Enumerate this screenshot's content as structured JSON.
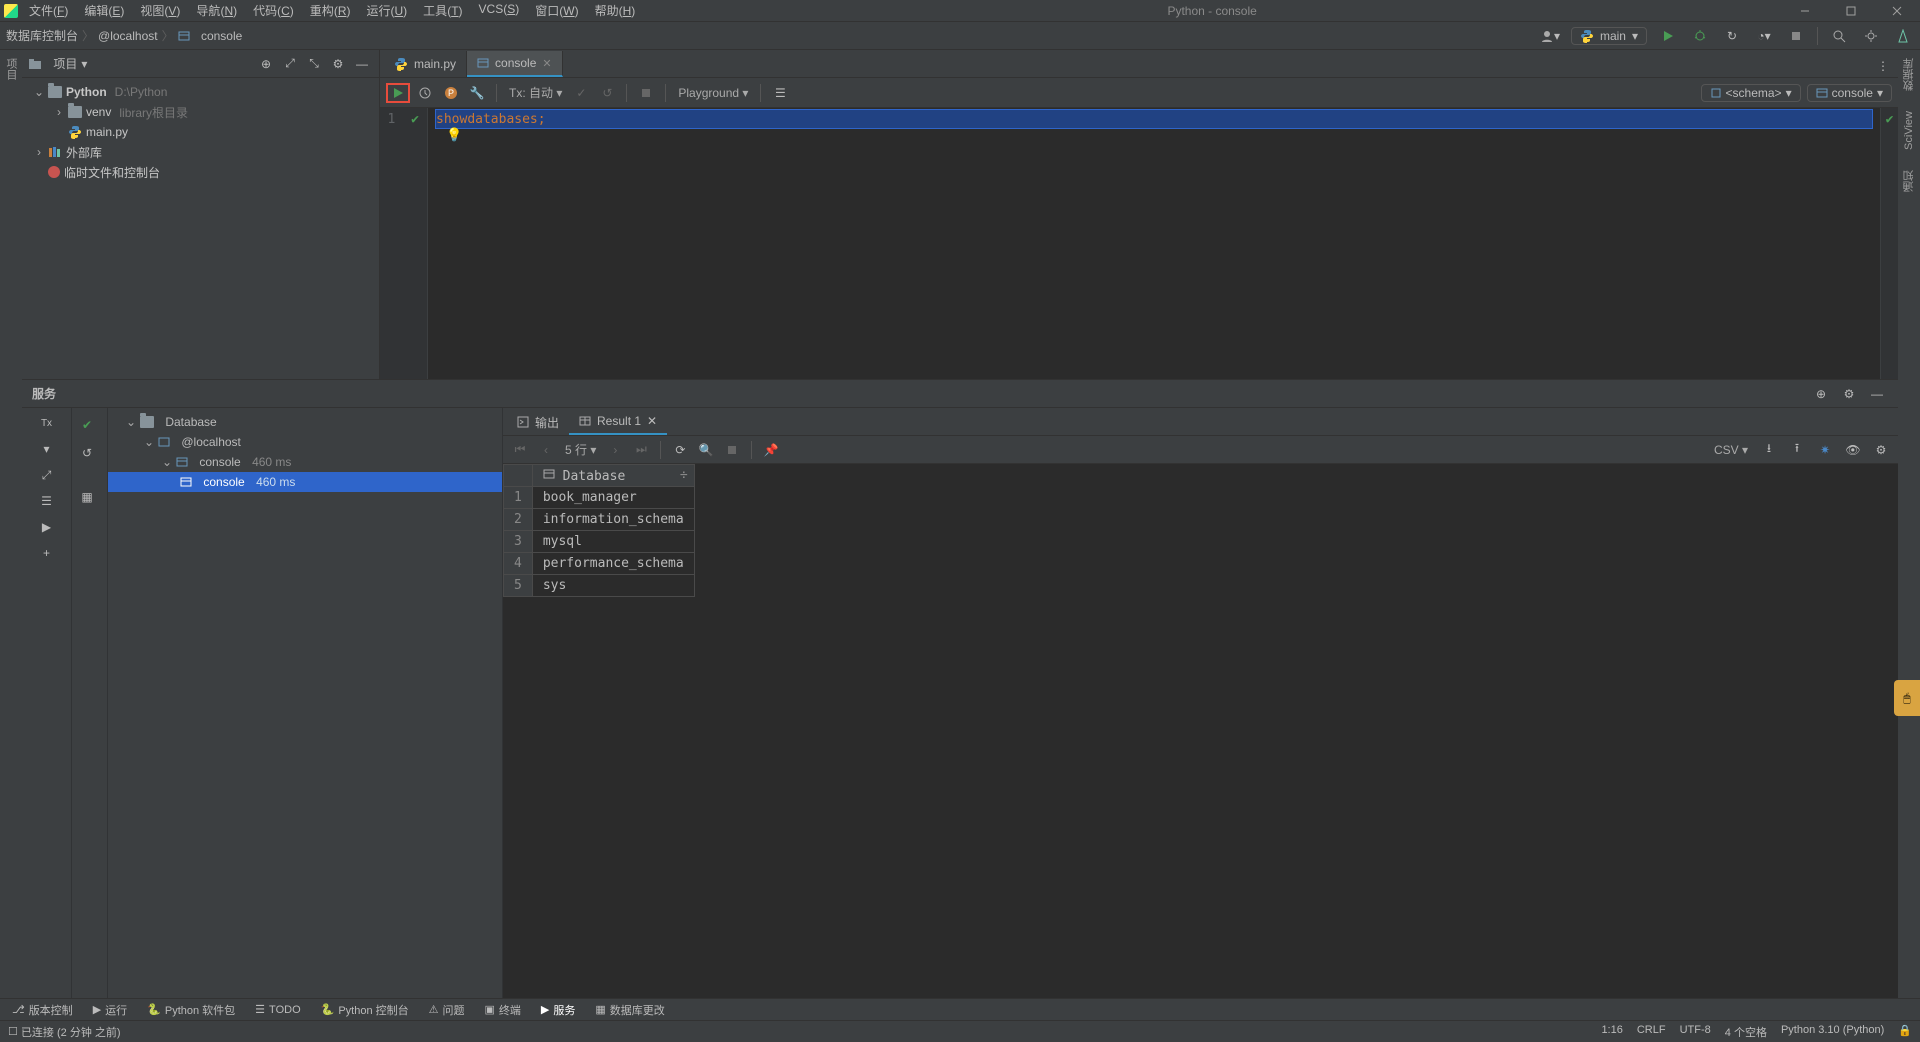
{
  "window": {
    "title": "Python - console"
  },
  "menu": {
    "items": [
      {
        "label": "文件",
        "key": "F"
      },
      {
        "label": "编辑",
        "key": "E"
      },
      {
        "label": "视图",
        "key": "V"
      },
      {
        "label": "导航",
        "key": "N"
      },
      {
        "label": "代码",
        "key": "C"
      },
      {
        "label": "重构",
        "key": "R"
      },
      {
        "label": "运行",
        "key": "U"
      },
      {
        "label": "工具",
        "key": "T"
      },
      {
        "label": "VCS",
        "key": "S"
      },
      {
        "label": "窗口",
        "key": "W"
      },
      {
        "label": "帮助",
        "key": "H"
      }
    ]
  },
  "breadcrumb": {
    "items": [
      "数据库控制台",
      "@localhost",
      "console"
    ]
  },
  "navright": {
    "run_label": "main"
  },
  "left_strip": {
    "label": "项目"
  },
  "right_strip": {
    "labels": [
      "数据库",
      "SciView",
      "通知"
    ]
  },
  "project": {
    "dropdown": "项目",
    "root": "Python",
    "root_path": "D:\\Python",
    "items": [
      {
        "name": "venv",
        "hint": "library根目录",
        "indent": 1,
        "expandable": true
      },
      {
        "name": "main.py",
        "indent": 1,
        "type": "py"
      }
    ],
    "libs": "外部库",
    "scratch": "临时文件和控制台"
  },
  "tabs": {
    "items": [
      {
        "label": "main.py",
        "type": "py",
        "active": false
      },
      {
        "label": "console",
        "type": "db",
        "active": true
      }
    ]
  },
  "editor_toolbar": {
    "tx": "Tx: 自动",
    "playground": "Playground",
    "schema": "<schema>",
    "console_lbl": "console"
  },
  "code": {
    "line_no": "1",
    "tokens": {
      "t1": "show",
      "t2": " ",
      "t3": "databases",
      "t4": ";"
    }
  },
  "services": {
    "title": "服务",
    "tree": [
      {
        "label": "Database",
        "indent": 0,
        "type": "folder"
      },
      {
        "label": "@localhost",
        "indent": 1,
        "type": "host"
      },
      {
        "label": "console",
        "hint": "460 ms",
        "indent": 2,
        "type": "console"
      },
      {
        "label": "console",
        "hint": "460 ms",
        "indent": 3,
        "type": "console",
        "sel": true
      }
    ],
    "result_tabs": [
      {
        "label": "输出"
      },
      {
        "label": "Result 1",
        "active": true
      }
    ],
    "result_tb": {
      "rows_label": "5 行",
      "csv": "CSV"
    },
    "result_header": "Database",
    "rows": [
      "book_manager",
      "information_schema",
      "mysql",
      "performance_schema",
      "sys"
    ]
  },
  "tool_toolbar": {
    "items": [
      "Tx"
    ]
  },
  "bottom": {
    "tabs": [
      {
        "label": "版本控制"
      },
      {
        "label": "运行"
      },
      {
        "label": "Python 软件包"
      },
      {
        "label": "TODO"
      },
      {
        "label": "Python 控制台"
      },
      {
        "label": "问题"
      },
      {
        "label": "终端"
      },
      {
        "label": "服务",
        "active": true
      },
      {
        "label": "数据库更改"
      }
    ]
  },
  "status": {
    "conn": "已连接 (2 分钟 之前)",
    "pos": "1:16",
    "eol": "CRLF",
    "enc": "UTF-8",
    "indent": "4 个空格",
    "interp": "Python 3.10 (Python)"
  }
}
